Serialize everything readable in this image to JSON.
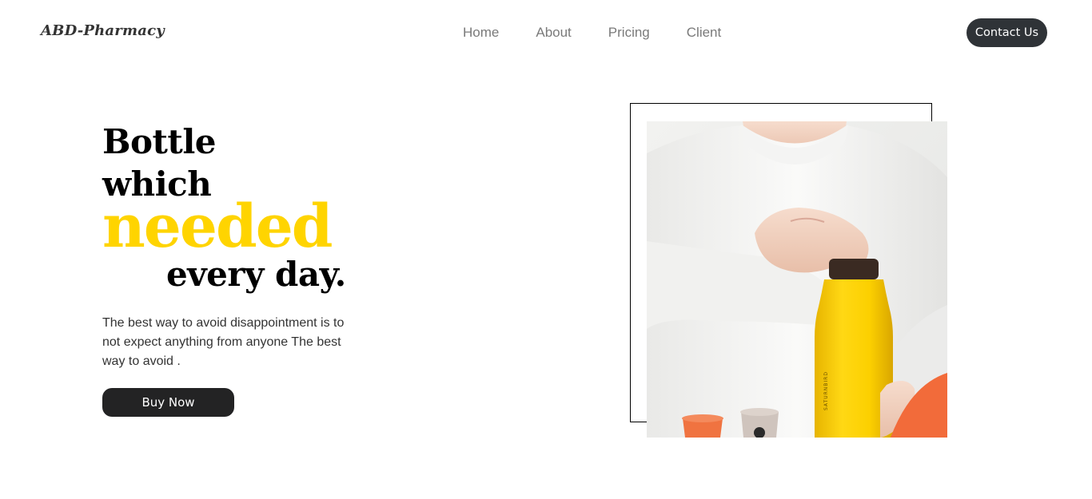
{
  "header": {
    "logo": "ABD-Pharmacy",
    "nav": [
      {
        "label": "Home"
      },
      {
        "label": "About"
      },
      {
        "label": "Pricing"
      },
      {
        "label": "Client"
      }
    ],
    "contact_label": "Contact Us"
  },
  "hero": {
    "headline": {
      "line1": "Bottle",
      "line2": "which",
      "line3": "needed",
      "line4": "every day."
    },
    "description": "The best way to avoid disappointment is to not expect anything from anyone The best way to avoid .",
    "buy_label": "Buy Now",
    "image": {
      "subject": "person-opening-yellow-bottle",
      "bottle_text": "SATURNBIRD"
    }
  },
  "colors": {
    "accent": "#ffd400",
    "button_dark": "#2f3337",
    "text_muted": "#7a7a7a",
    "orange": "#f26b3a"
  }
}
